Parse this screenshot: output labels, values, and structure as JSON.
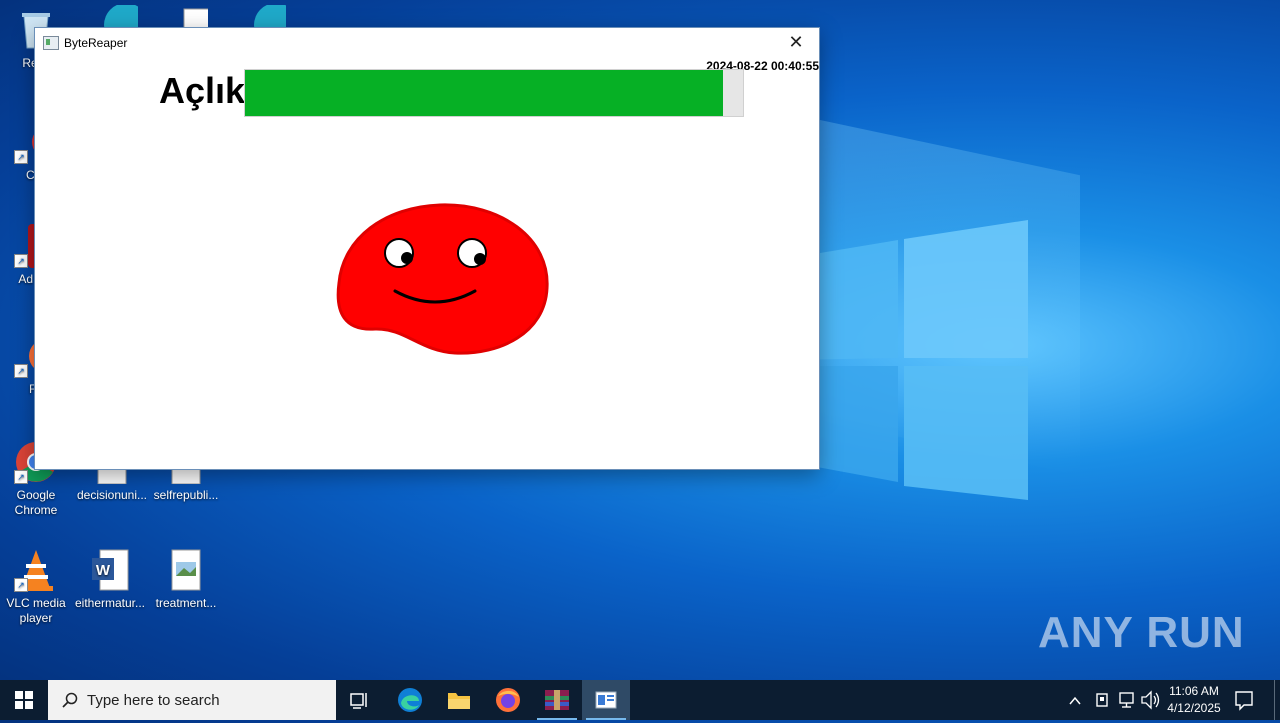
{
  "window": {
    "title": "ByteReaper",
    "close_glyph": "✕",
    "timestamp": "2024-08-22 00:40:55",
    "hunger_label": "Açlık",
    "hunger_level": 0.96,
    "bar_color": "#06b025",
    "pet_color": "#ff0000"
  },
  "desktop_icons": [
    {
      "label": "Recy",
      "icon": "recycle-bin-icon"
    },
    {
      "label": "CCl",
      "icon": "ccleaner-icon"
    },
    {
      "label": "Ad Acr",
      "icon": "adobe-acrobat-icon"
    },
    {
      "label": "Fir",
      "icon": "firefox-icon"
    },
    {
      "label": "Google Chrome",
      "icon": "chrome-icon"
    },
    {
      "label": "decisionuni...",
      "icon": "document-icon"
    },
    {
      "label": "selfrepubli...",
      "icon": "document-icon"
    },
    {
      "label": "VLC media player",
      "icon": "vlc-icon"
    },
    {
      "label": "eithermatur...",
      "icon": "word-icon"
    },
    {
      "label": "treatment...",
      "icon": "image-file-icon"
    }
  ],
  "watermark": "ANY RUN",
  "taskbar": {
    "search_placeholder": "Type here to search",
    "time": "11:06 AM",
    "date": "4/12/2025"
  }
}
